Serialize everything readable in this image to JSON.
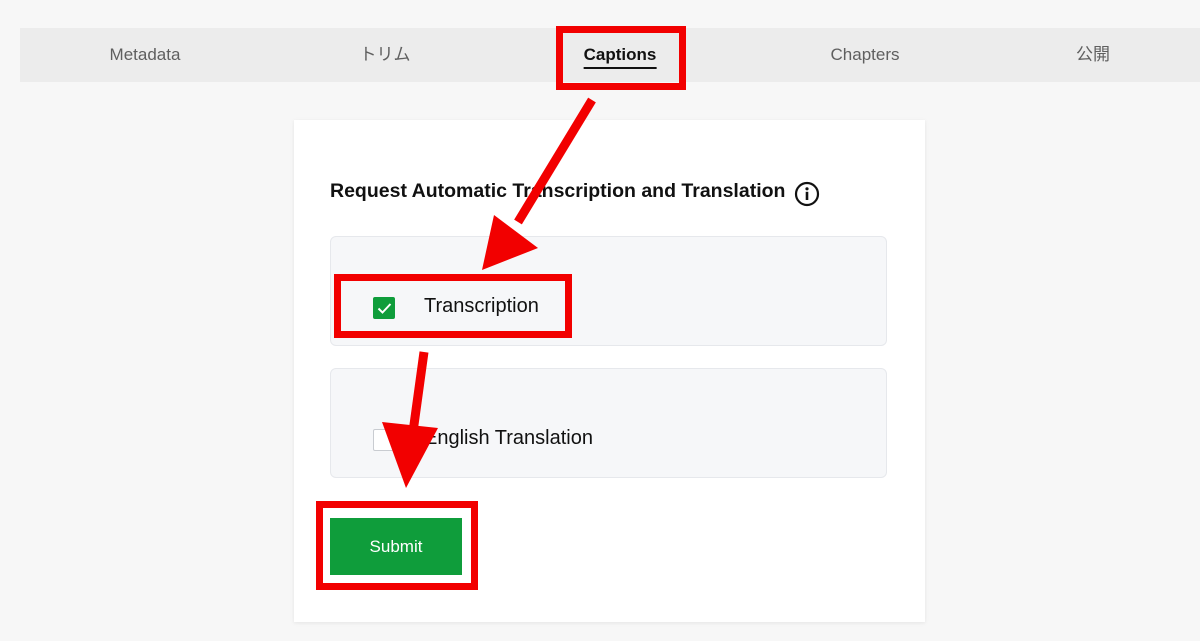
{
  "tabs": [
    {
      "label": "Metadata",
      "active": false
    },
    {
      "label": "トリム",
      "active": false
    },
    {
      "label": "Captions",
      "active": true
    },
    {
      "label": "Chapters",
      "active": false
    },
    {
      "label": "公開",
      "active": false
    }
  ],
  "card": {
    "heading": "Request Automatic Transcription and Translation",
    "heading_icon": "info-circle-icon",
    "options": [
      {
        "label": "Transcription",
        "checked": true
      },
      {
        "label": "English Translation",
        "checked": false
      }
    ],
    "submit_label": "Submit"
  },
  "colors": {
    "accent_green": "#0f9d3b",
    "annotation_red": "#f20000",
    "tabbar_bg": "#ececec",
    "page_bg": "#f7f7f7"
  }
}
